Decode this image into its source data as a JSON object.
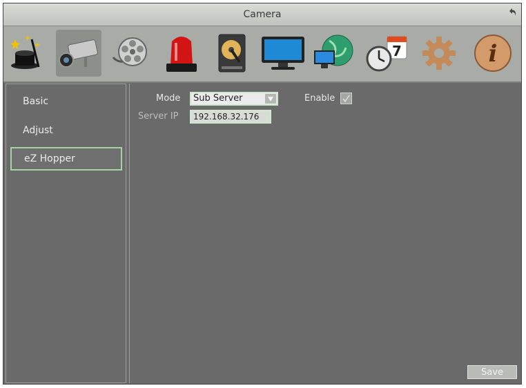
{
  "window": {
    "title": "Camera"
  },
  "toolbar": {
    "icons": [
      "magic-wizard-icon",
      "camera-icon",
      "film-reel-icon",
      "alarm-siren-icon",
      "hard-disk-icon",
      "monitor-icon",
      "network-globe-icon",
      "schedule-clock-calendar-icon",
      "gear-icon",
      "info-icon"
    ],
    "calendar_day": "7",
    "info_glyph": "i"
  },
  "sidebar": {
    "items": [
      {
        "label": "Basic"
      },
      {
        "label": "Adjust"
      },
      {
        "label": "eZ Hopper"
      }
    ]
  },
  "form": {
    "mode_label": "Mode",
    "mode_value": "Sub Server",
    "enable_label": "Enable",
    "enable_checked": true,
    "server_ip_label": "Server IP",
    "server_ip_value": "192.168.32.176"
  },
  "buttons": {
    "save_label": "Save"
  }
}
